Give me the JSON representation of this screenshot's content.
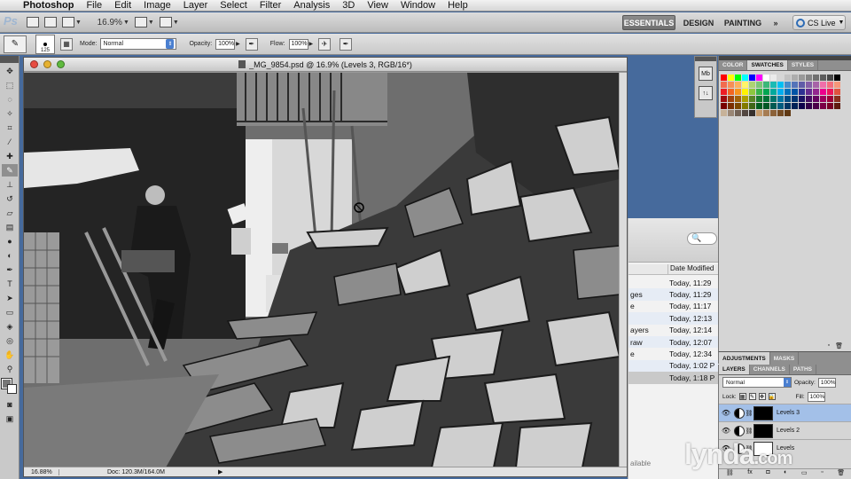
{
  "menubar": {
    "apple": "",
    "app": "Photoshop",
    "items": [
      "File",
      "Edit",
      "Image",
      "Layer",
      "Select",
      "Filter",
      "Analysis",
      "3D",
      "View",
      "Window",
      "Help"
    ]
  },
  "appbar": {
    "logo": "Ps",
    "zoom": "16.9%",
    "workspaces": [
      "ESSENTIALS",
      "DESIGN",
      "PAINTING"
    ],
    "more": "»",
    "cslive": "CS Live"
  },
  "options": {
    "brush_size": "125",
    "mode_label": "Mode:",
    "mode_value": "Normal",
    "opacity_label": "Opacity:",
    "opacity_value": "100%",
    "flow_label": "Flow:",
    "flow_value": "100%"
  },
  "document": {
    "title": "_MG_9854.psd @ 16.9% (Levels 3, RGB/16*)",
    "zoom": "16.88%",
    "doc_size": "Doc: 120.3M/164.0M",
    "play": "▶"
  },
  "bridge": {
    "search_icon": "magnifier",
    "search_glyph": "🔍",
    "column_header": "Date Modified",
    "rows": [
      {
        "name": "",
        "date": "Today, 11:29"
      },
      {
        "name": "ges",
        "date": "Today, 11:29"
      },
      {
        "name": "e",
        "date": "Today, 11:17"
      },
      {
        "name": "",
        "date": "Today, 12:13"
      },
      {
        "name": "ayers",
        "date": "Today, 12:14"
      },
      {
        "name": "raw",
        "date": "Today, 12:07"
      },
      {
        "name": "e",
        "date": "Today, 12:34"
      },
      {
        "name": "",
        "date": "Today, 1:02 P"
      },
      {
        "name": "",
        "date": "Today, 1:18 P"
      }
    ],
    "status": "ailable"
  },
  "minidock": {
    "icons": [
      "Mb",
      "↑↓"
    ]
  },
  "swatch_panel": {
    "tabs": [
      "COLOR",
      "SWATCHES",
      "STYLES"
    ],
    "active_tab": "SWATCHES",
    "swatch_colors": [
      "#ff0000",
      "#ffff00",
      "#00ff00",
      "#00ffff",
      "#0000ff",
      "#ff00ff",
      "#ffffff",
      "#ebebeb",
      "#d6d6d6",
      "#c2c2c2",
      "#adadad",
      "#999999",
      "#858585",
      "#707070",
      "#5c5c5c",
      "#474747",
      "#000000",
      "#f26c4f",
      "#f68e56",
      "#fbaf5d",
      "#fff568",
      "#acd373",
      "#7cc576",
      "#3bb878",
      "#1abbb4",
      "#00bff3",
      "#448ccb",
      "#5574b9",
      "#605ca8",
      "#855fa8",
      "#a763a8",
      "#f06ea9",
      "#f26d7d",
      "#f79679",
      "#ed1c24",
      "#f26522",
      "#f7941d",
      "#fff200",
      "#8dc73f",
      "#39b54a",
      "#00a651",
      "#00a99d",
      "#00aeef",
      "#0072bc",
      "#0054a6",
      "#2e3192",
      "#662d91",
      "#92278f",
      "#ec008c",
      "#ed145b",
      "#e0523f",
      "#9e0b0f",
      "#a0410d",
      "#a36209",
      "#aba000",
      "#598527",
      "#1a7b30",
      "#007236",
      "#00746b",
      "#0076a3",
      "#004a80",
      "#003471",
      "#1b1464",
      "#440e62",
      "#630460",
      "#9e005d",
      "#9e0039",
      "#8b2f1e",
      "#790000",
      "#7b2e00",
      "#7d4900",
      "#827b00",
      "#406618",
      "#005e20",
      "#005826",
      "#005952",
      "#005b7f",
      "#003663",
      "#002157",
      "#0d004c",
      "#32004b",
      "#4b0049",
      "#7b0046",
      "#7a0026",
      "#5f1b0f",
      "#c7b299",
      "#998675",
      "#736357",
      "#534741",
      "#37302d",
      "#c69c6d",
      "#a67c52",
      "#8c6239",
      "#754c24",
      "#603913"
    ]
  },
  "adjustments": {
    "tabs": [
      "ADJUSTMENTS",
      "MASKS"
    ]
  },
  "layers_panel": {
    "tabs": [
      "LAYERS",
      "CHANNELS",
      "PATHS"
    ],
    "blend_mode": "Normal",
    "opacity_label": "Opacity:",
    "opacity_value": "100%",
    "lock_label": "Lock:",
    "fill_label": "Fill:",
    "fill_value": "100%",
    "layers": [
      {
        "name": "Levels 3",
        "selected": true
      },
      {
        "name": "Levels 2",
        "selected": false
      },
      {
        "name": "Levels",
        "selected": false
      }
    ]
  },
  "watermark": {
    "brand": "lynda",
    "suffix": ".com"
  }
}
